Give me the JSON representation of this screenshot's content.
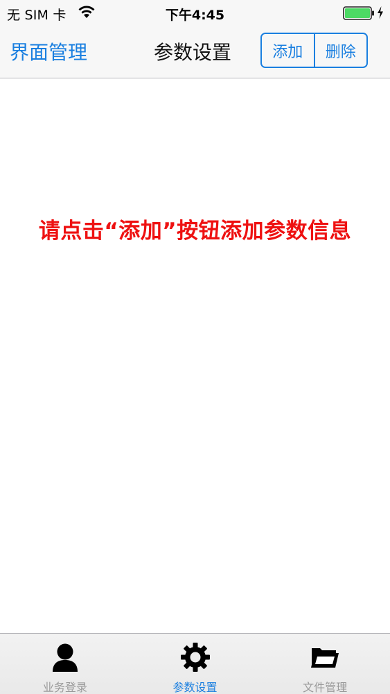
{
  "status_bar": {
    "carrier": "无 SIM 卡",
    "time": "下午4:45",
    "icons": [
      "wifi-icon",
      "battery-icon",
      "charging-icon"
    ],
    "battery_color": "#4cd964"
  },
  "nav_bar": {
    "back_label": "界面管理",
    "title": "参数设置",
    "add_label": "添加",
    "delete_label": "删除"
  },
  "main": {
    "hint": "请点击“添加”按钮添加参数信息",
    "hint_color": "#ee1111"
  },
  "tab_bar": {
    "active_index": 1,
    "tabs": [
      {
        "label": "业务登录",
        "icon": "person-icon"
      },
      {
        "label": "参数设置",
        "icon": "gear-icon"
      },
      {
        "label": "文件管理",
        "icon": "folder-icon"
      }
    ]
  },
  "colors": {
    "accent": "#1a7fe0",
    "bar_background": "#f7f7f7"
  }
}
